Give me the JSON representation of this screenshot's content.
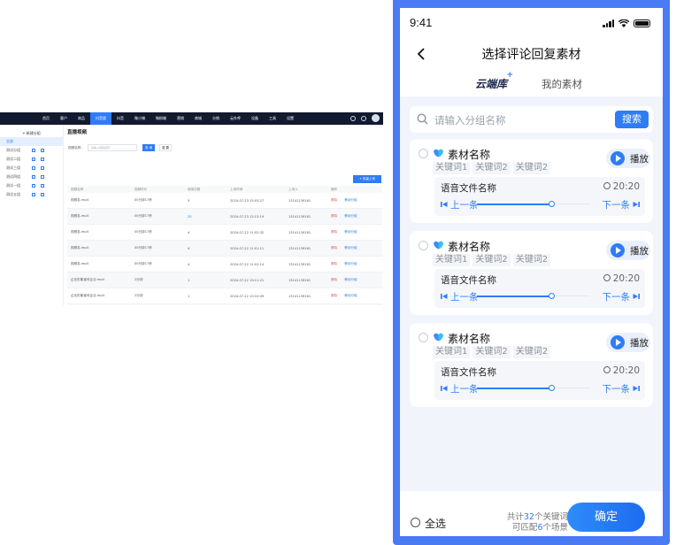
{
  "desktop": {
    "nav": [
      "首页",
      "客户",
      "商品",
      "抖音版",
      "抖音",
      "微小铺",
      "微粉端",
      "营销",
      "商城",
      "分销",
      "云外呼",
      "设备",
      "工具",
      "设置"
    ],
    "nav_active_index": 3,
    "sidebar_new": "+ 新建分组",
    "sidebar_items": [
      "全部",
      "测试分组",
      "测试二组",
      "测试三组",
      "测试四组",
      "测试一组",
      "测试五组"
    ],
    "page_title": "直播视频",
    "filter_label": "视频名称：",
    "filter_placeholder": "请输入视频名称",
    "search_label": "查 询",
    "reset_label": "重 置",
    "upload_label": "+ 批量上传",
    "columns": [
      "视频名称",
      "视频时长",
      "使用次数",
      "上传时间",
      "上传人",
      "操作"
    ],
    "rows": [
      [
        "视频名.mp4",
        "00分钟17秒",
        "5",
        "2024-07-23 15:03:27",
        "13141139161"
      ],
      [
        "视频名.mp4",
        "00分钟17秒",
        "20",
        "2024-07-23 12:13:19",
        "13141139161"
      ],
      [
        "视频名.mp4",
        "00分钟17秒",
        "4",
        "2024-07-22 11:02:32",
        "13141139161"
      ],
      [
        "视频名.mp4",
        "00分钟17秒",
        "4",
        "2024-07-22 11:01:11",
        "13141139161"
      ],
      [
        "视频名.mp4",
        "00分钟17秒",
        "4",
        "2024-07-22 11:02:14",
        "13141139161"
      ],
      [
        "企业形象宣传企业.mp4",
        "2分钟",
        "1",
        "2024-07-22 19:11:21",
        "13141139161"
      ],
      [
        "企业形象宣传企业.mp4",
        "2分钟",
        "1",
        "2024-07-22 10:10:09",
        "13141139161"
      ],
      [
        "企业形象宣传企业.mp4",
        "2分钟",
        "1",
        "2024-07-22 10:10:00",
        "13141139161"
      ]
    ],
    "op_delete": "删除",
    "op_edit": "移动分组"
  },
  "phone": {
    "status_time": "9:41",
    "title": "选择评论回复素材",
    "tab_library": "云端库",
    "tab_plus": "+",
    "tab_mine": "我的素材",
    "search_placeholder": "请输入分组名称",
    "search_button": "搜索",
    "cards": [
      {
        "name": "素材名称",
        "keywords": [
          "关键词1",
          "关键词2",
          "关键词2"
        ],
        "play": "播放",
        "audio_name": "语音文件名称",
        "duration": "20:20",
        "prev": "上一条",
        "next": "下一条",
        "progress_percent": 82
      },
      {
        "name": "素材名称",
        "keywords": [
          "关键词1",
          "关键词2",
          "关键词2"
        ],
        "play": "播放",
        "audio_name": "语音文件名称",
        "duration": "20:20",
        "prev": "上一条",
        "next": "下一条",
        "progress_percent": 82
      },
      {
        "name": "素材名称",
        "keywords": [
          "关键词1",
          "关键词2",
          "关键词2"
        ],
        "play": "播放",
        "audio_name": "语音文件名称",
        "duration": "20:20",
        "prev": "上一条",
        "next": "下一条",
        "progress_percent": 82
      }
    ],
    "select_all": "全选",
    "summary_line1_pre": "共计",
    "summary_keywords": "32",
    "summary_line1_post": "个关键词",
    "summary_line2_pre": "可匹配",
    "summary_scenes": "6",
    "summary_line2_post": "个场景",
    "confirm": "确定"
  },
  "colors": {
    "accent": "#2f7cf6",
    "frame": "#4b7af5",
    "nav_bg": "#111a2e",
    "page_bg": "#f1f4fb"
  }
}
